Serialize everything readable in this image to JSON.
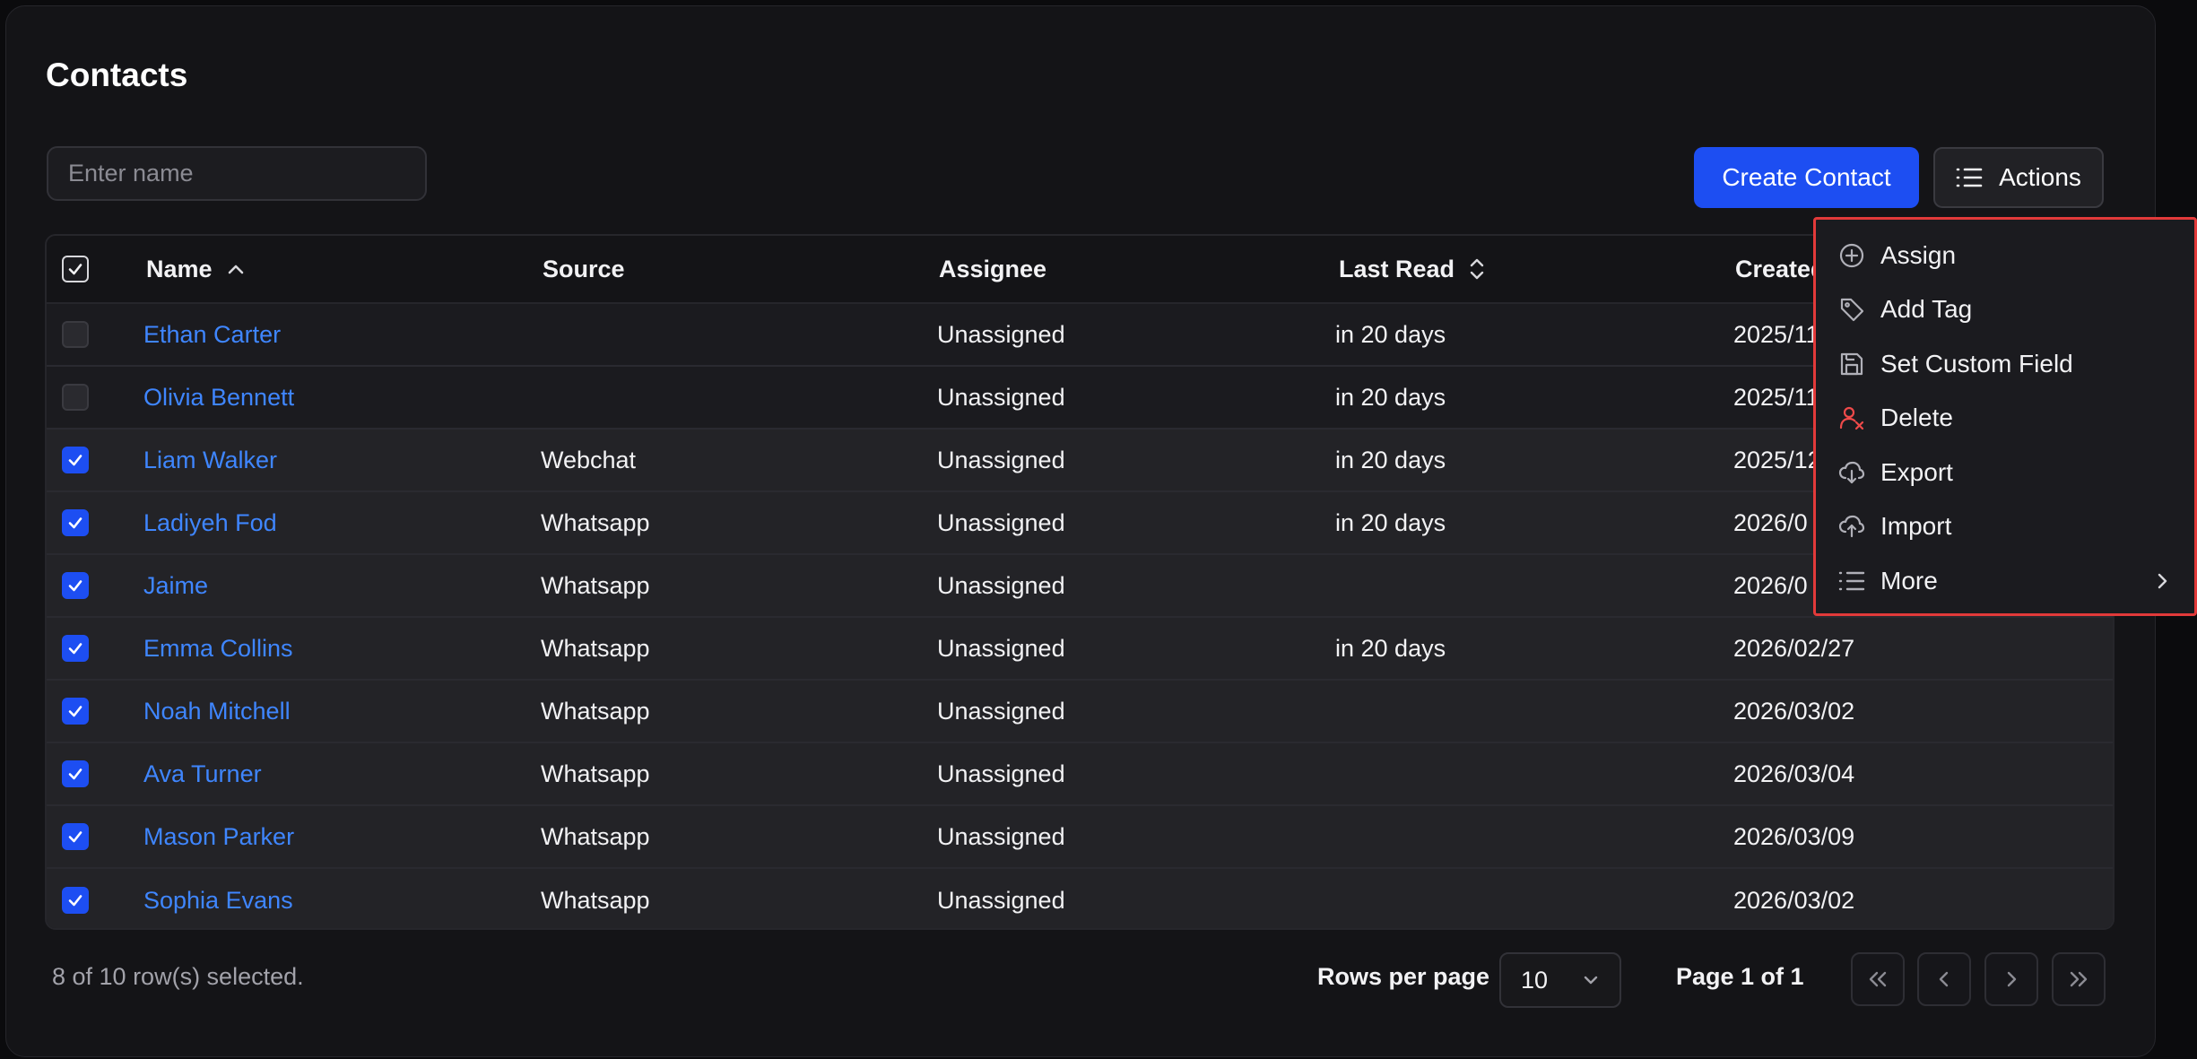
{
  "page": {
    "title": "Contacts"
  },
  "search": {
    "placeholder": "Enter name"
  },
  "toolbar": {
    "create_label": "Create Contact",
    "actions_label": "Actions"
  },
  "table": {
    "headers": {
      "name": "Name",
      "source": "Source",
      "assignee": "Assignee",
      "last_read": "Last Read",
      "created": "Created"
    },
    "rows": [
      {
        "name": "Ethan Carter",
        "source": "",
        "assignee": "Unassigned",
        "last_read": "in 20 days",
        "created": "2025/11",
        "checked": false
      },
      {
        "name": "Olivia Bennett",
        "source": "",
        "assignee": "Unassigned",
        "last_read": "in 20 days",
        "created": "2025/11",
        "checked": false
      },
      {
        "name": "Liam Walker",
        "source": "Webchat",
        "assignee": "Unassigned",
        "last_read": "in 20 days",
        "created": "2025/12",
        "checked": true
      },
      {
        "name": "Ladiyeh Fod",
        "source": "Whatsapp",
        "assignee": "Unassigned",
        "last_read": "in 20 days",
        "created": "2026/0",
        "checked": true
      },
      {
        "name": "Jaime",
        "source": "Whatsapp",
        "assignee": "Unassigned",
        "last_read": "",
        "created": "2026/0",
        "checked": true
      },
      {
        "name": "Emma Collins",
        "source": "Whatsapp",
        "assignee": "Unassigned",
        "last_read": "in 20 days",
        "created": "2026/02/27",
        "checked": true
      },
      {
        "name": "Noah Mitchell",
        "source": "Whatsapp",
        "assignee": "Unassigned",
        "last_read": "",
        "created": "2026/03/02",
        "checked": true
      },
      {
        "name": "Ava Turner",
        "source": "Whatsapp",
        "assignee": "Unassigned",
        "last_read": "",
        "created": "2026/03/04",
        "checked": true
      },
      {
        "name": "Mason Parker",
        "source": "Whatsapp",
        "assignee": "Unassigned",
        "last_read": "",
        "created": "2026/03/09",
        "checked": true
      },
      {
        "name": "Sophia Evans",
        "source": "Whatsapp",
        "assignee": "Unassigned",
        "last_read": "",
        "created": "2026/03/02",
        "checked": true
      }
    ]
  },
  "footer": {
    "selection": "8 of 10 row(s) selected.",
    "rows_per_page_label": "Rows per page",
    "rows_per_page_value": "10",
    "page_info": "Page 1 of 1"
  },
  "menu": {
    "items": [
      {
        "label": "Assign",
        "icon": "plus-circle-icon"
      },
      {
        "label": "Add Tag",
        "icon": "tag-icon"
      },
      {
        "label": "Set Custom Field",
        "icon": "save-icon"
      },
      {
        "label": "Delete",
        "icon": "user-x-icon"
      },
      {
        "label": "Export",
        "icon": "cloud-download-icon"
      },
      {
        "label": "Import",
        "icon": "cloud-upload-icon"
      },
      {
        "label": "More",
        "icon": "list-icon"
      }
    ]
  },
  "colors": {
    "accent": "#1d4ef2",
    "link": "#3f86ff",
    "danger": "#e23a3a",
    "background": "#141417"
  }
}
